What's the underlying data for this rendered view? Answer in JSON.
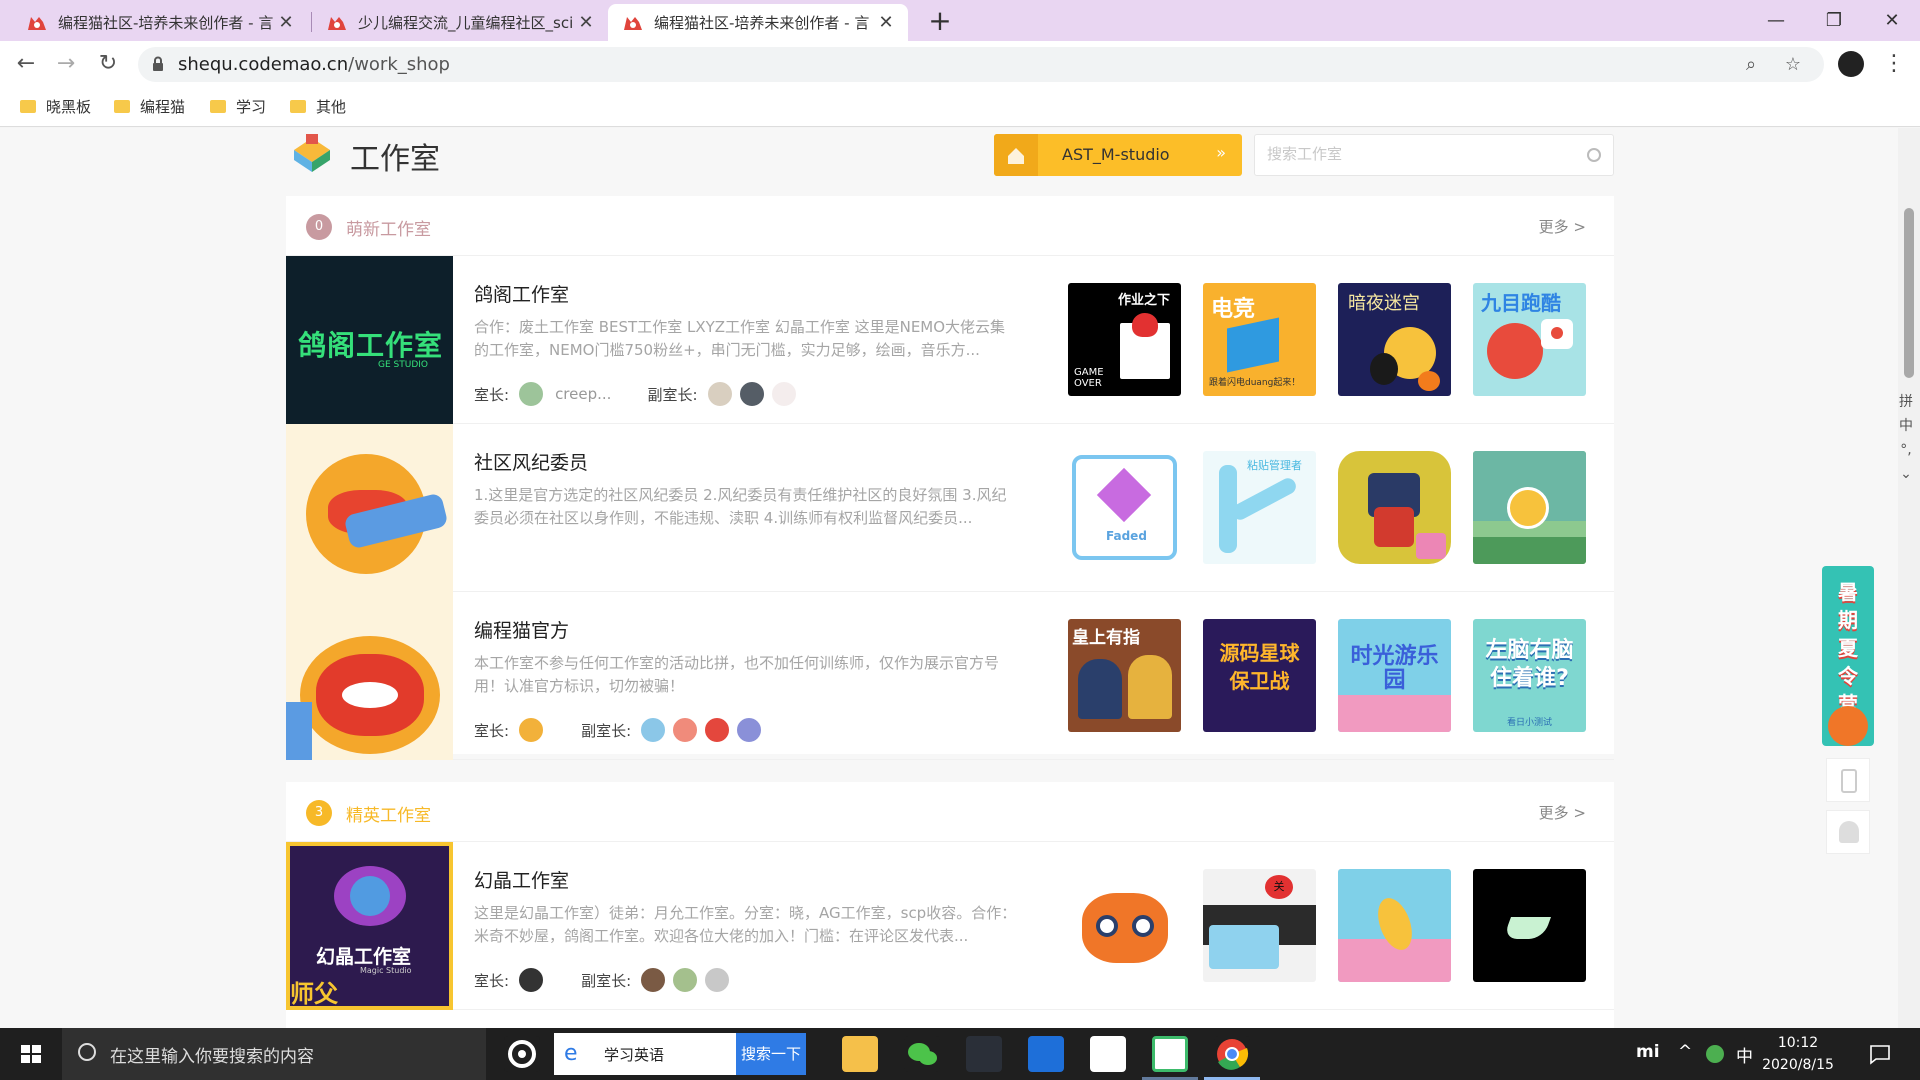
{
  "browser": {
    "tabs": [
      {
        "title": "编程猫社区-培养未来创作者 - 言",
        "active": false
      },
      {
        "title": "少儿编程交流_儿童编程社区_sci",
        "active": false
      },
      {
        "title": "编程猫社区-培养未来创作者 - 言",
        "active": true
      }
    ],
    "new_tab": "+",
    "window_controls": {
      "minimize": "—",
      "maximize": "❐",
      "close": "✕"
    },
    "url_host": "shequ.codemao.cn",
    "url_path": "/work_shop",
    "bookmarks": [
      "晓黑板",
      "编程猫",
      "学习",
      "其他"
    ]
  },
  "header": {
    "title": "工作室",
    "my_studio": "AST_M-studio",
    "my_studio_arrow": "»",
    "search_placeholder": "搜索工作室"
  },
  "sections": [
    {
      "badge": "0",
      "title": "萌新工作室",
      "more": "更多 >",
      "color": "#c89aa0",
      "studios": [
        {
          "name": "鸽阁工作室",
          "cover_text": "鸽阁工作室",
          "cover_sub": "GE STUDIO",
          "description": "合作：废土工作室 BEST工作室 LXYZ工作室 幻晶工作室 这里是NEMO大佬云集的工作室，NEMO门槛750粉丝+，串门无门槛，实力足够，绘画，音乐方...",
          "leader_label": "室长:",
          "leader_name": "creep...",
          "deputy_label": "副室长:",
          "deputy_count": 3
        },
        {
          "name": "社区风纪委员",
          "description": "1.这里是官方选定的社区风纪委员 2.风纪委员有责任维护社区的良好氛围 3.风纪委员必须在社区以身作则，不能违规、渎职 4.训练师有权利监督风纪委员...",
          "leader_label": "",
          "leader_name": "",
          "deputy_label": "",
          "deputy_count": 0
        },
        {
          "name": "编程猫官方",
          "description": "本工作室不参与任何工作室的活动比拼，也不加任何训练师，仅作为展示官方号用！认准官方标识，切勿被骗！",
          "leader_label": "室长:",
          "leader_name": "",
          "deputy_label": "副室长:",
          "deputy_count": 4
        }
      ]
    },
    {
      "badge": "3",
      "title": "精英工作室",
      "more": "更多 >",
      "color": "#f7b928",
      "studios": [
        {
          "name": "幻晶工作室",
          "cover_text": "幻晶工作室",
          "cover_sub": "Magic Studio",
          "cover_tag": "师父",
          "description": "这里是幻晶工作室）徒弟：月允工作室。分室：晓，AG工作室，scp收容。合作：米奇不妙屋，鸽阁工作室。欢迎各位大佬的加入！门槛：在评论区发代表...",
          "leader_label": "室长:",
          "leader_name": "",
          "deputy_label": "副室长:",
          "deputy_count": 3
        }
      ]
    }
  ],
  "works_text": {
    "r0w0": "作业之下",
    "r0w0b": "GAME OVER",
    "r0w1": "电竞",
    "r0w1b": "跟着闪电duang起来！",
    "r0w2": "暗夜迷宫",
    "r0w3": "九目跑酷",
    "r1w0": "Faded",
    "r1w1": "粘贴管理者",
    "r2w0": "皇上有指",
    "r2w1": "源码星球 保卫战",
    "r2w2": "时光游乐园",
    "r2w3": "左脑右脑 住着谁?",
    "r2w3b": "看日小测试",
    "r3w1": "关"
  },
  "side": {
    "ad_text": "暑期 夏令营",
    "ime_chars": [
      "拼",
      "中",
      "°,",
      "⌄"
    ]
  },
  "taskbar": {
    "search_placeholder": "在这里输入你要搜索的内容",
    "ie_query": "学习英语",
    "ie_button": "搜索一下",
    "tray_brand": "mi",
    "tray_caret": "^",
    "tray_ime": "中",
    "time": "10:12",
    "date": "2020/8/15"
  }
}
